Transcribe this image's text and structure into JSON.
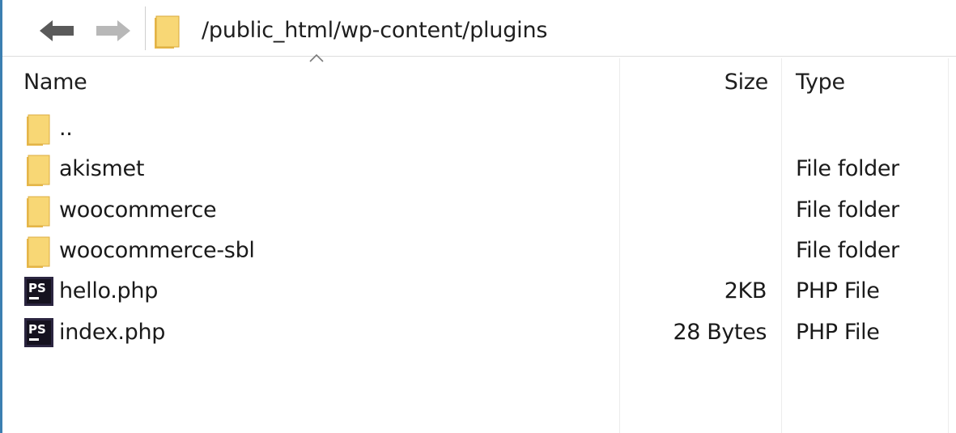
{
  "address_bar": {
    "back_icon": "arrow-left-icon",
    "forward_icon": "arrow-right-icon",
    "folder_icon": "folder-icon",
    "path": "/public_html/wp-content/plugins"
  },
  "columns": {
    "name": "Name",
    "size": "Size",
    "type": "Type",
    "sort_icon": "sort-ascending-icon"
  },
  "files": [
    {
      "name": "..",
      "size": "",
      "type": "",
      "icon": "folder-icon"
    },
    {
      "name": "akismet",
      "size": "",
      "type": "File folder",
      "icon": "folder-icon"
    },
    {
      "name": "woocommerce",
      "size": "",
      "type": "File folder",
      "icon": "folder-icon"
    },
    {
      "name": "woocommerce-sbl",
      "size": "",
      "type": "File folder",
      "icon": "folder-icon"
    },
    {
      "name": "hello.php",
      "size": "2KB",
      "type": "PHP File",
      "icon": "phpstorm-file-icon"
    },
    {
      "name": "index.php",
      "size": "28 Bytes",
      "type": "PHP File",
      "icon": "phpstorm-file-icon"
    }
  ],
  "colors": {
    "folder_fill": "#f8d775",
    "folder_shade": "#e8b84a",
    "php_icon_bg": "#2b2540",
    "accent_border": "#3c7fb1"
  }
}
